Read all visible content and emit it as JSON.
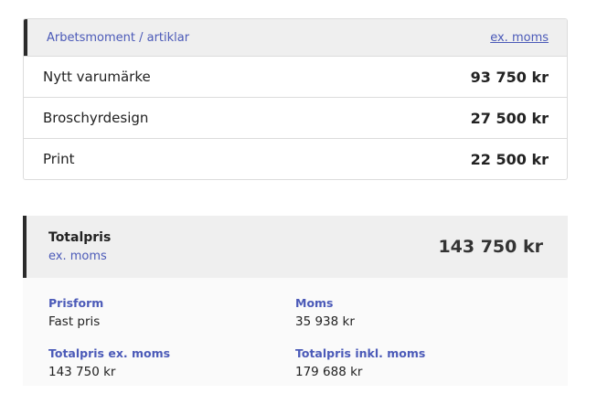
{
  "items_table": {
    "header_left": "Arbetsmoment / artiklar",
    "header_right": "ex. moms",
    "rows": [
      {
        "name": "Nytt varumärke",
        "price": "93 750 kr"
      },
      {
        "name": "Broschyrdesign",
        "price": "27 500 kr"
      },
      {
        "name": "Print",
        "price": "22 500 kr"
      }
    ]
  },
  "total": {
    "label": "Totalpris",
    "sublabel": "ex. moms",
    "amount": "143 750 kr"
  },
  "details": [
    {
      "label": "Prisform",
      "value": "Fast pris"
    },
    {
      "label": "Moms",
      "value": "35 938 kr"
    },
    {
      "label": "Totalpris ex. moms",
      "value": "143 750 kr"
    },
    {
      "label": "Totalpris inkl. moms",
      "value": "179 688 kr"
    }
  ],
  "colors": {
    "accent": "#4b5ab8",
    "header_bg": "#efefef",
    "border_dark": "#2b2b2b"
  }
}
